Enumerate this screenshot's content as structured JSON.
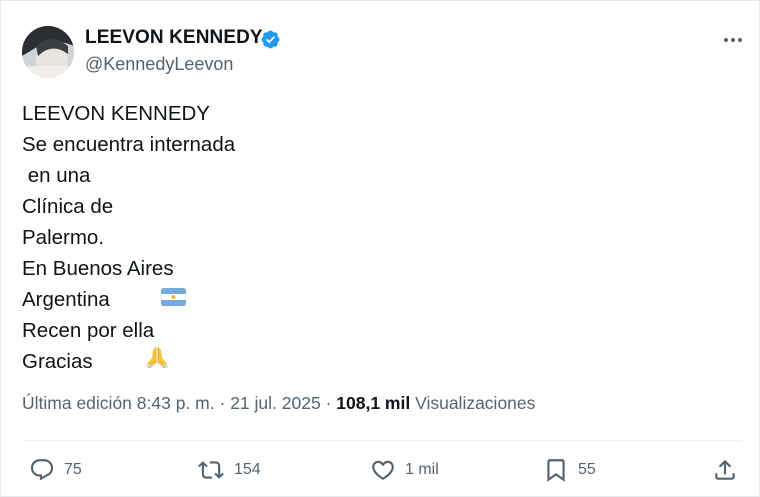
{
  "author": {
    "name": "LEEVON KENNEDY",
    "handle": "@KennedyLeevon",
    "verified_color": "#1d9bf0"
  },
  "more_icon": "more-horizontal-icon",
  "tweet": {
    "lines": [
      "LEEVON KENNEDY",
      "Se encuentra internada",
      " en una",
      "Clínica de",
      "Palermo.",
      "En Buenos Aires",
      "Argentina",
      "Recen por ella",
      "Gracias"
    ],
    "emojis": {
      "line7": "argentina-flag",
      "line9": "folded-hands"
    }
  },
  "meta": {
    "edited": "Última edición",
    "time": "8:43 p. m.",
    "sep1": "·",
    "date": "21 jul. 2025",
    "sep2": "·",
    "views_count": "108,1 mil",
    "views_label": "Visualizaciones"
  },
  "actions": {
    "replies": "75",
    "reposts": "154",
    "likes": "1 mil",
    "bookmarks": "55"
  },
  "colors": {
    "text": "#0f1419",
    "secondary": "#536471",
    "divider": "#eff3f4"
  }
}
